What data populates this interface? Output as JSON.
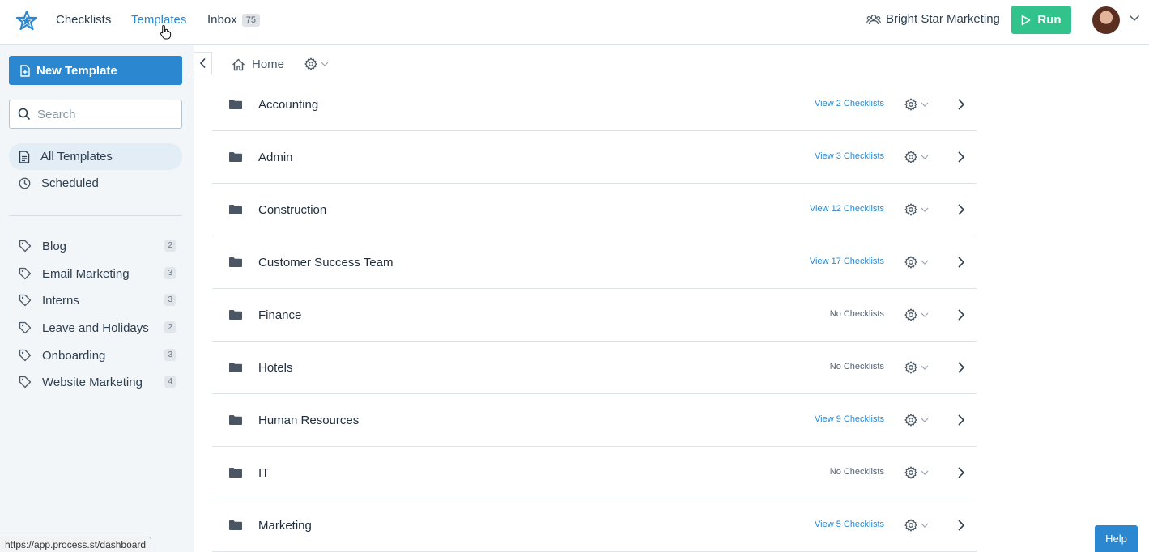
{
  "nav": {
    "checklists": "Checklists",
    "templates": "Templates",
    "inbox": "Inbox",
    "inbox_count": "75",
    "org_name": "Bright Star Marketing",
    "run_label": "Run"
  },
  "sidebar": {
    "new_template_label": "New Template",
    "search_placeholder": "Search",
    "all_templates": "All Templates",
    "scheduled": "Scheduled",
    "tags": [
      {
        "label": "Blog",
        "count": "2"
      },
      {
        "label": "Email Marketing",
        "count": "3"
      },
      {
        "label": "Interns",
        "count": "3"
      },
      {
        "label": "Leave and Holidays",
        "count": "2"
      },
      {
        "label": "Onboarding",
        "count": "3"
      },
      {
        "label": "Website Marketing",
        "count": "4"
      }
    ]
  },
  "breadcrumb": {
    "home": "Home"
  },
  "folders": [
    {
      "name": "Accounting",
      "link": "View 2 Checklists"
    },
    {
      "name": "Admin",
      "link": "View 3 Checklists"
    },
    {
      "name": "Construction",
      "link": "View 12 Checklists"
    },
    {
      "name": "Customer Success Team",
      "link": "View 17 Checklists"
    },
    {
      "name": "Finance",
      "link": "No Checklists"
    },
    {
      "name": "Hotels",
      "link": "No Checklists"
    },
    {
      "name": "Human Resources",
      "link": "View 9 Checklists"
    },
    {
      "name": "IT",
      "link": "No Checklists"
    },
    {
      "name": "Marketing",
      "link": "View 5 Checklists"
    }
  ],
  "status_url": "https://app.process.st/dashboard",
  "help_label": "Help",
  "colors": {
    "accent": "#2a87d0",
    "run": "#32c28c"
  }
}
